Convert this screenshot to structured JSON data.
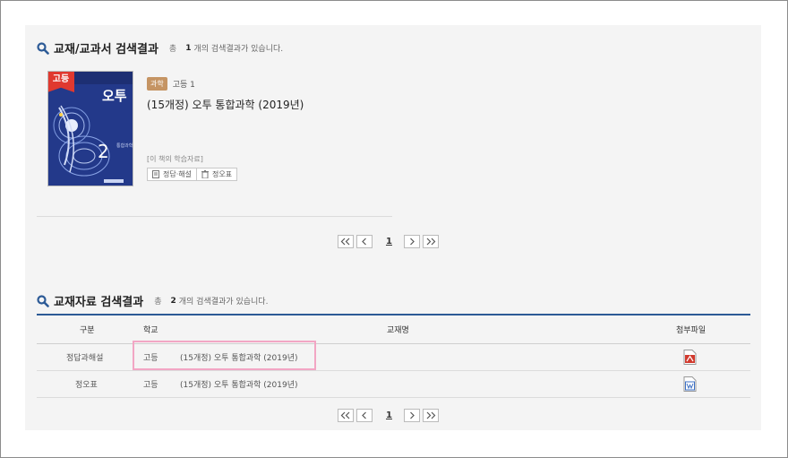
{
  "colors": {
    "accent_blue": "#2c5a96",
    "level_badge": "#e0392f",
    "subject_tag": "#c59463",
    "highlight": "#f2a6c4"
  },
  "textbook_section": {
    "title": "교재/교과서 검색결과",
    "total_label": "총",
    "count": "1",
    "count_suffix": "개의 검색결과가 있습니다.",
    "book": {
      "level_badge": "고등",
      "subject_tag": "과학",
      "grade": "고등 1",
      "title": "(15개정) 오투 통합과학 (2019년)",
      "materials_label": "[이 책의 학습자료]",
      "materials": [
        "정답·해설",
        "정오표"
      ]
    },
    "pagination": {
      "current_page": "1"
    }
  },
  "materials_section": {
    "title": "교재자료 검색결과",
    "total_label": "총",
    "count": "2",
    "count_suffix": "개의 검색결과가 있습니다.",
    "columns": [
      "구분",
      "학교",
      "교재명",
      "첨부파일"
    ],
    "rows": [
      {
        "category": "정답과해설",
        "school": "고등",
        "book_name": "(15개정) 오투 통합과학 (2019년)",
        "file": "pdf-file-icon"
      },
      {
        "category": "정오표",
        "school": "고등",
        "book_name": "(15개정) 오투 통합과학 (2019년)",
        "file": "document-file-icon"
      }
    ],
    "pagination": {
      "current_page": "1"
    }
  }
}
